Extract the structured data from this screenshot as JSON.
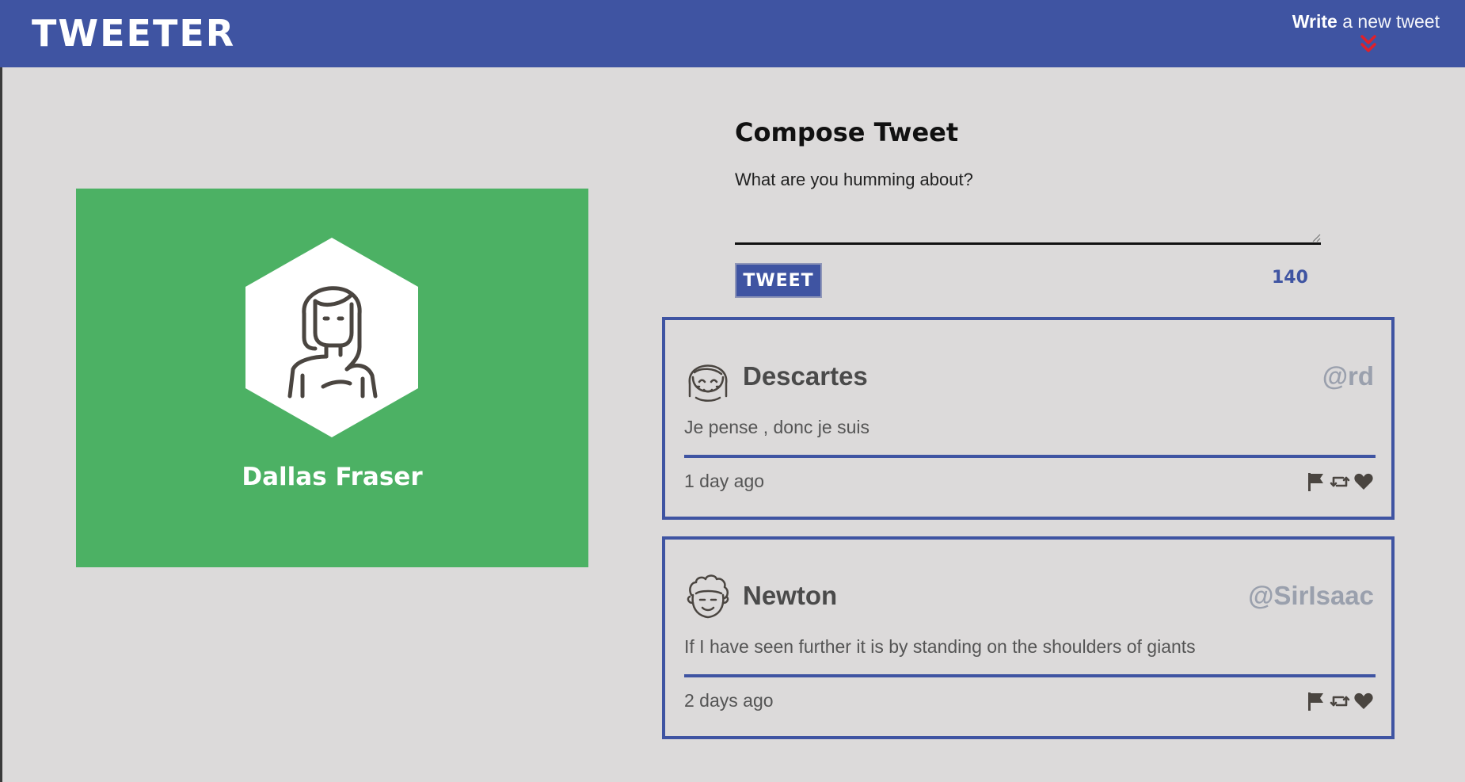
{
  "nav": {
    "logo": "TWEETER",
    "write_strong": "Write",
    "write_rest": " a new tweet",
    "icons": {
      "toggle": "double-chevron-down-icon"
    },
    "colors": {
      "bar": "#3f54a2",
      "chevron": "#e0202a"
    }
  },
  "profile": {
    "name": "Dallas Fraser",
    "avatar": "woman-avatar-icon",
    "colors": {
      "card": "#4cb164"
    }
  },
  "compose": {
    "title": "Compose Tweet",
    "placeholder": "What are you humming about?",
    "value": "",
    "button_label": "TWEET",
    "counter": "140"
  },
  "tweets": [
    {
      "name": "Descartes",
      "handle": "@rd",
      "content": "Je pense , donc je suis",
      "time": "1 day ago",
      "avatar": "girl-avatar-icon"
    },
    {
      "name": "Newton",
      "handle": "@SirIsaac",
      "content": "If I have seen further it is by standing on the shoulders of giants",
      "time": "2 days ago",
      "avatar": "curly-haired-man-avatar-icon"
    }
  ],
  "actions": {
    "icons": [
      "flag-icon",
      "retweet-icon",
      "heart-icon"
    ]
  }
}
